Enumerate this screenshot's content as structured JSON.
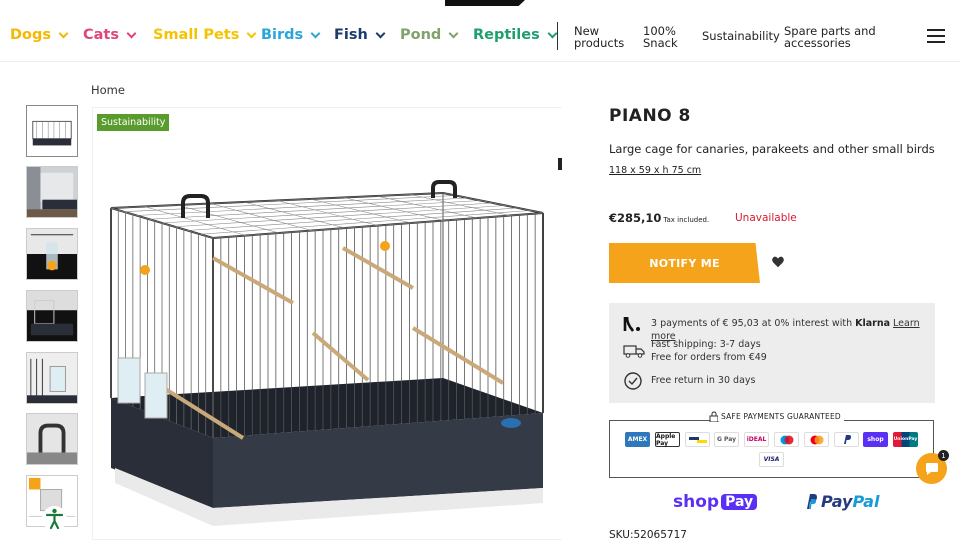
{
  "nav": {
    "items": [
      {
        "label": "Dogs",
        "color": "#f5b800"
      },
      {
        "label": "Cats",
        "color": "#e0457b"
      },
      {
        "label": "Small Pets",
        "color": "#f5c400"
      },
      {
        "label": "Birds",
        "color": "#2ba6d9"
      },
      {
        "label": "Fish",
        "color": "#1c3c6b"
      },
      {
        "label": "Pond",
        "color": "#7fa36a"
      },
      {
        "label": "Reptiles",
        "color": "#1e9f6e"
      }
    ],
    "links": {
      "new_1": "New",
      "new_2": "products",
      "snack_1": "100%",
      "snack_2": "Snack",
      "sustainability": "Sustainability",
      "spare_1": "Spare parts and",
      "spare_2": "accessories"
    },
    "menu_icon": "hamburger-icon"
  },
  "breadcrumb": "Home",
  "gallery": {
    "badge": "Sustainability",
    "thumbnail_count": 7
  },
  "product": {
    "title": "PIANO 8",
    "subtitle": "Large cage for canaries, parakeets and other small birds",
    "dimensions": "118 x 59 x h 75 cm",
    "price": "€285,10",
    "tax_note": "Tax included.",
    "availability": "Unavailable",
    "notify_label": "NOTIFY ME",
    "wishlist_icon": "heart-icon"
  },
  "info": {
    "klarna_text": "3 payments of € 95,03 at 0% interest with",
    "klarna_brand": "Klarna",
    "klarna_link": "Learn more",
    "shipping_title": "Fast shipping: 3-7 days",
    "shipping_sub": "Free for orders from €49",
    "returns": "Free return in 30 days"
  },
  "payments": {
    "label": "SAFE PAYMENTS GUARANTEED",
    "methods": [
      "AMEX",
      "Apple Pay",
      "Bancontact",
      "G Pay",
      "iDEAL",
      "Maestro",
      "Mastercard",
      "PayPal",
      "shop",
      "UnionPay",
      "VISA"
    ]
  },
  "shoppay": {
    "shop": "shop",
    "pay": "Pay"
  },
  "paypal": {
    "pay": "Pay",
    "pal": "Pal"
  },
  "sku": "SKU:52065717",
  "chat": {
    "badge": "1"
  },
  "colors": {
    "accent": "#f5a31b",
    "unavailable": "#d7192f",
    "badge_green": "#5a9b2d"
  }
}
